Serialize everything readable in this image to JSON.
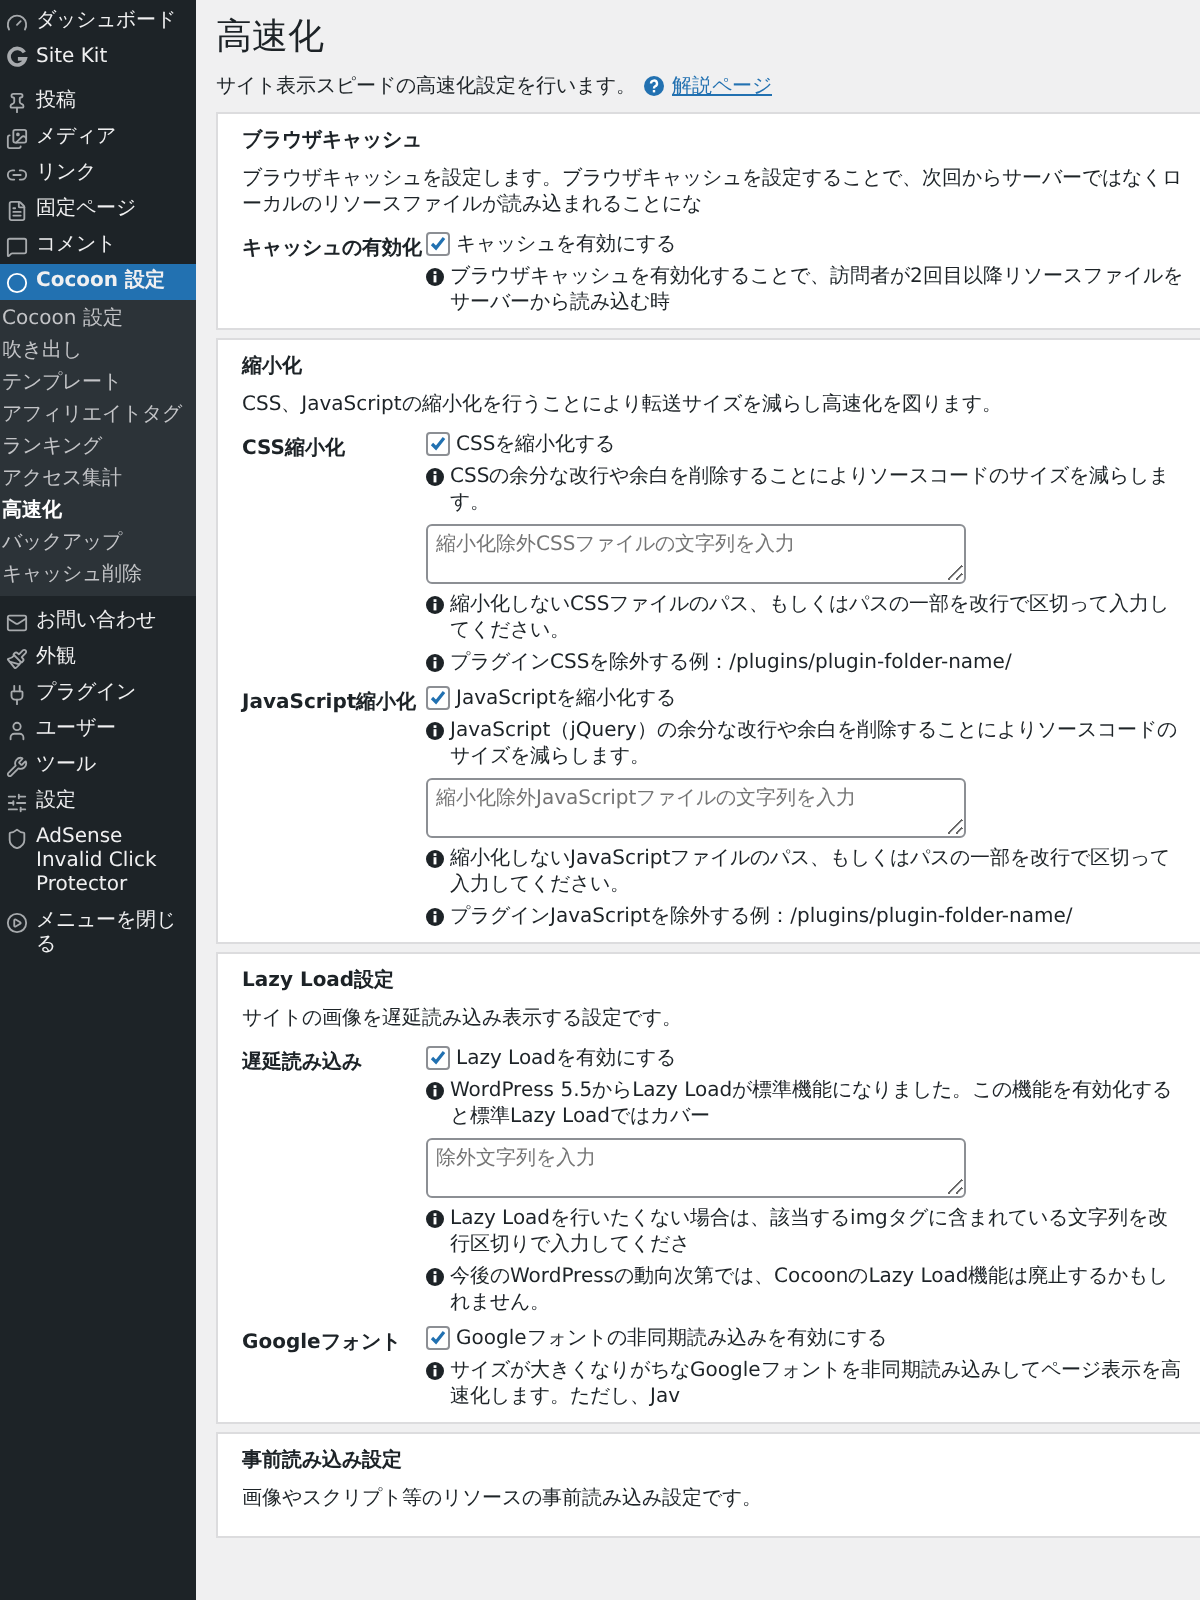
{
  "sidebar": {
    "items": [
      {
        "label": "ダッシュボード",
        "selected": false
      },
      {
        "label": "Site Kit",
        "selected": false
      },
      {
        "label": "投稿",
        "selected": false
      },
      {
        "label": "メディア",
        "selected": false
      },
      {
        "label": "リンク",
        "selected": false
      },
      {
        "label": "固定ページ",
        "selected": false
      },
      {
        "label": "コメント",
        "selected": false
      },
      {
        "label": "Cocoon 設定",
        "selected": true,
        "children": [
          {
            "label": "Cocoon 設定",
            "selected": false
          },
          {
            "label": "吹き出し",
            "selected": false
          },
          {
            "label": "テンプレート",
            "selected": false
          },
          {
            "label": "アフィリエイトタグ",
            "selected": false
          },
          {
            "label": "ランキング",
            "selected": false
          },
          {
            "label": "アクセス集計",
            "selected": false
          },
          {
            "label": "高速化",
            "selected": true
          },
          {
            "label": "バックアップ",
            "selected": false
          },
          {
            "label": "キャッシュ削除",
            "selected": false
          }
        ]
      },
      {
        "label": "お問い合わせ",
        "selected": false
      },
      {
        "label": "外観",
        "selected": false
      },
      {
        "label": "プラグイン",
        "selected": false
      },
      {
        "label": "ユーザー",
        "selected": false
      },
      {
        "label": "ツール",
        "selected": false
      },
      {
        "label": "設定",
        "selected": false
      },
      {
        "label": "AdSense Invalid Click Protector",
        "selected": false
      },
      {
        "label": "メニューを閉じる",
        "selected": false
      }
    ]
  },
  "page": {
    "title": "高速化",
    "description": "サイト表示スピードの高速化設定を行います。",
    "help_link": "解説ページ"
  },
  "sections": [
    {
      "heading": "ブラウザキャッシュ",
      "description": "ブラウザキャッシュを設定します。ブラウザキャッシュを設定することで、次回からサーバーではなくローカルのリソースファイルが読み込まれることにな",
      "settings": [
        {
          "label": "キャッシュの有効化",
          "items": [
            {
              "kind": "checkbox",
              "label": "キャッシュを有効にする",
              "checked": true
            },
            {
              "kind": "note",
              "text": "ブラウザキャッシュを有効化することで、訪問者が2回目以降リソースファイルをサーバーから読み込む時"
            }
          ]
        }
      ]
    },
    {
      "heading": "縮小化",
      "description": "CSS、JavaScriptの縮小化を行うことにより転送サイズを減らし高速化を図ります。",
      "settings": [
        {
          "label": "CSS縮小化",
          "items": [
            {
              "kind": "checkbox",
              "label": "CSSを縮小化する",
              "checked": true
            },
            {
              "kind": "note",
              "text": "CSSの余分な改行や余白を削除することによりソースコードのサイズを減らします。"
            },
            {
              "kind": "textarea",
              "placeholder": "縮小化除外CSSファイルの文字列を入力"
            },
            {
              "kind": "note",
              "text": "縮小化しないCSSファイルのパス、もしくはパスの一部を改行で区切って入力してください。"
            },
            {
              "kind": "note",
              "text": "プラグインCSSを除外する例：/plugins/plugin-folder-name/"
            }
          ]
        },
        {
          "label": "JavaScript縮小化",
          "items": [
            {
              "kind": "checkbox",
              "label": "JavaScriptを縮小化する",
              "checked": true
            },
            {
              "kind": "note",
              "text": "JavaScript（jQuery）の余分な改行や余白を削除することによりソースコードのサイズを減らします。"
            },
            {
              "kind": "textarea",
              "placeholder": "縮小化除外JavaScriptファイルの文字列を入力"
            },
            {
              "kind": "note",
              "text": "縮小化しないJavaScriptファイルのパス、もしくはパスの一部を改行で区切って入力してください。"
            },
            {
              "kind": "note",
              "text": "プラグインJavaScriptを除外する例：/plugins/plugin-folder-name/"
            }
          ]
        }
      ]
    },
    {
      "heading": "Lazy Load設定",
      "description": "サイトの画像を遅延読み込み表示する設定です。",
      "settings": [
        {
          "label": "遅延読み込み",
          "items": [
            {
              "kind": "checkbox",
              "label": "Lazy Loadを有効にする",
              "checked": true
            },
            {
              "kind": "note",
              "text": "WordPress 5.5からLazy Loadが標準機能になりました。この機能を有効化すると標準Lazy Loadではカバー"
            },
            {
              "kind": "textarea",
              "placeholder": "除外文字列を入力"
            },
            {
              "kind": "note",
              "text": "Lazy Loadを行いたくない場合は、該当するimgタグに含まれている文字列を改行区切りで入力してくださ"
            },
            {
              "kind": "note",
              "text": "今後のWordPressの動向次第では、CocoonのLazy Load機能は廃止するかもしれません。"
            }
          ]
        },
        {
          "label": "Googleフォント",
          "items": [
            {
              "kind": "checkbox",
              "label": "Googleフォントの非同期読み込みを有効にする",
              "checked": true
            },
            {
              "kind": "note",
              "text": "サイズが大きくなりがちなGoogleフォントを非同期読み込みしてページ表示を高速化します。ただし、Jav"
            }
          ]
        }
      ]
    },
    {
      "heading": "事前読み込み設定",
      "description": "画像やスクリプト等のリソースの事前読み込み設定です。"
    }
  ]
}
